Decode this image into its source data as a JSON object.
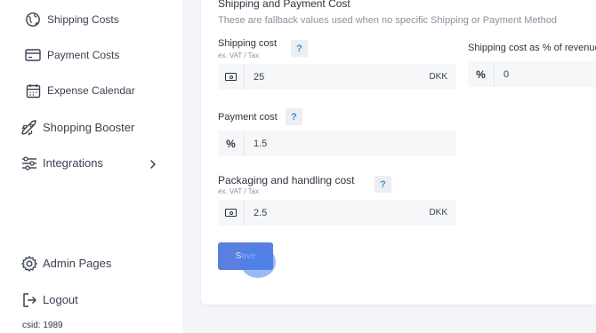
{
  "sidebar": {
    "items": [
      {
        "label": "Shipping Costs",
        "icon": "globe-icon"
      },
      {
        "label": "Payment Costs",
        "icon": "credit-card-icon"
      },
      {
        "label": "Expense Calendar",
        "icon": "calendar-icon"
      },
      {
        "label": "Shopping Booster",
        "icon": "rocket-icon"
      },
      {
        "label": "Integrations",
        "icon": "sliders-icon"
      },
      {
        "label": "Admin Pages",
        "icon": "gear-icon"
      },
      {
        "label": "Logout",
        "icon": "logout-icon"
      }
    ],
    "csid": "csid: 1989"
  },
  "section": {
    "title": "Shipping and Payment Cost",
    "description": "These are fallback values used when no specific Shipping or Payment Method"
  },
  "fields": {
    "shipping_cost": {
      "label": "Shipping cost",
      "sub": "ex. VAT / Tax",
      "help": "?",
      "prefix_icon": "cash-icon",
      "value": "25",
      "unit": "DKK"
    },
    "shipping_pct": {
      "label": "Shipping cost as % of revenue",
      "prefix": "%",
      "value": "0"
    },
    "payment_cost": {
      "label": "Payment cost",
      "help": "?",
      "prefix": "%",
      "value": "1.5"
    },
    "packaging_cost": {
      "label": "Packaging and handling cost",
      "sub": "ex. VAT / Tax",
      "help": "?",
      "prefix_icon": "cash-icon",
      "value": "2.5",
      "unit": "DKK"
    }
  },
  "save_label": "Save",
  "colors": {
    "accent": "#5b7fe0",
    "help": "#3b8fd8"
  }
}
